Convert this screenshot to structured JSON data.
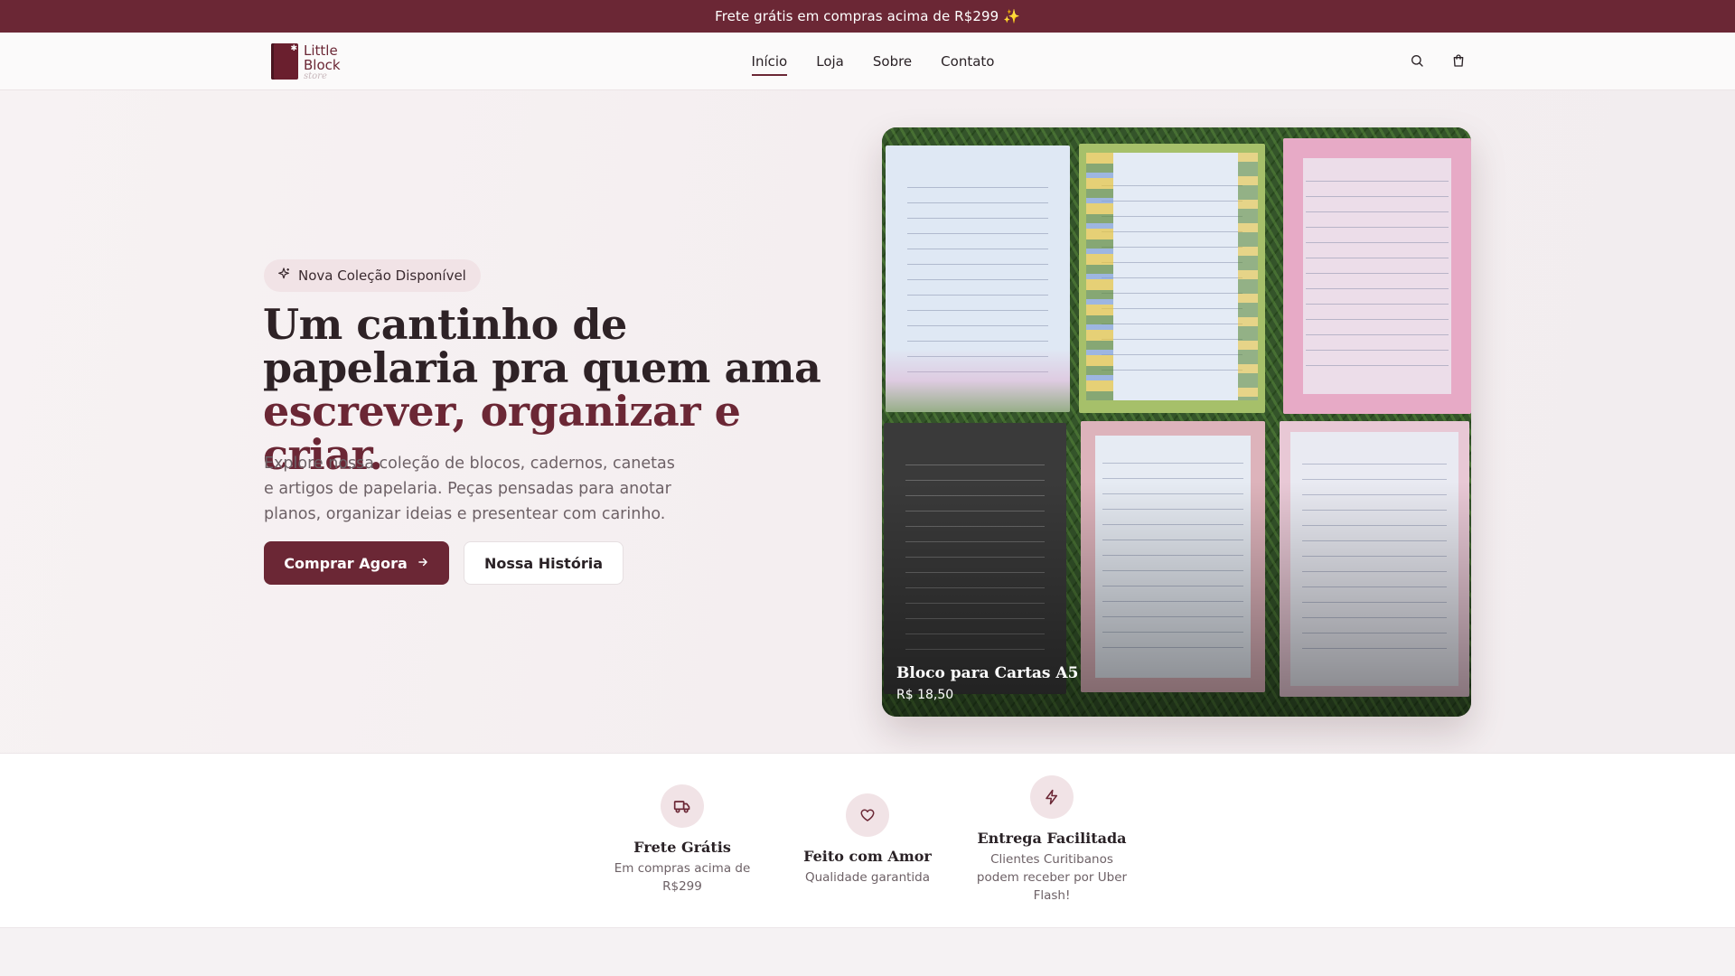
{
  "promo_bar": {
    "text": "Frete grátis em compras acima de R$299 ✨"
  },
  "header": {
    "logo": {
      "line1": "Little",
      "line2": "Block",
      "script": "store",
      "icon": "notebook-logo-icon"
    },
    "nav": [
      {
        "label": "Início",
        "active": true
      },
      {
        "label": "Loja",
        "active": false
      },
      {
        "label": "Sobre",
        "active": false
      },
      {
        "label": "Contato",
        "active": false
      }
    ],
    "icons": [
      "search-icon",
      "shopping-bag-icon"
    ]
  },
  "hero": {
    "badge": "Nova Coleção Disponível",
    "headline_part1": "Um cantinho de papelaria pra quem ama ",
    "headline_accent": "escrever, organizar e criar.",
    "description": "Explore nossa coleção de blocos, cadernos, canetas e artigos de papelaria. Peças pensadas para anotar planos, organizar ideias e presentear com carinho.",
    "primary_button": "Comprar Agora",
    "secondary_button": "Nossa História",
    "product": {
      "name": "Bloco para Cartas A5",
      "price": "R$ 18,50"
    }
  },
  "features": [
    {
      "icon": "truck-icon",
      "title": "Frete Grátis",
      "description": "Em compras acima de R$299"
    },
    {
      "icon": "heart-icon",
      "title": "Feito com Amor",
      "description": "Qualidade garantida"
    },
    {
      "icon": "lightning-icon",
      "title": "Entrega Facilitada",
      "description": "Clientes Curitibanos podem receber por Uber Flash!"
    }
  ],
  "colors": {
    "brand": "#6b2735",
    "badge_bg": "#f1e3e6",
    "text": "#2a2226",
    "muted": "#6d6166"
  }
}
